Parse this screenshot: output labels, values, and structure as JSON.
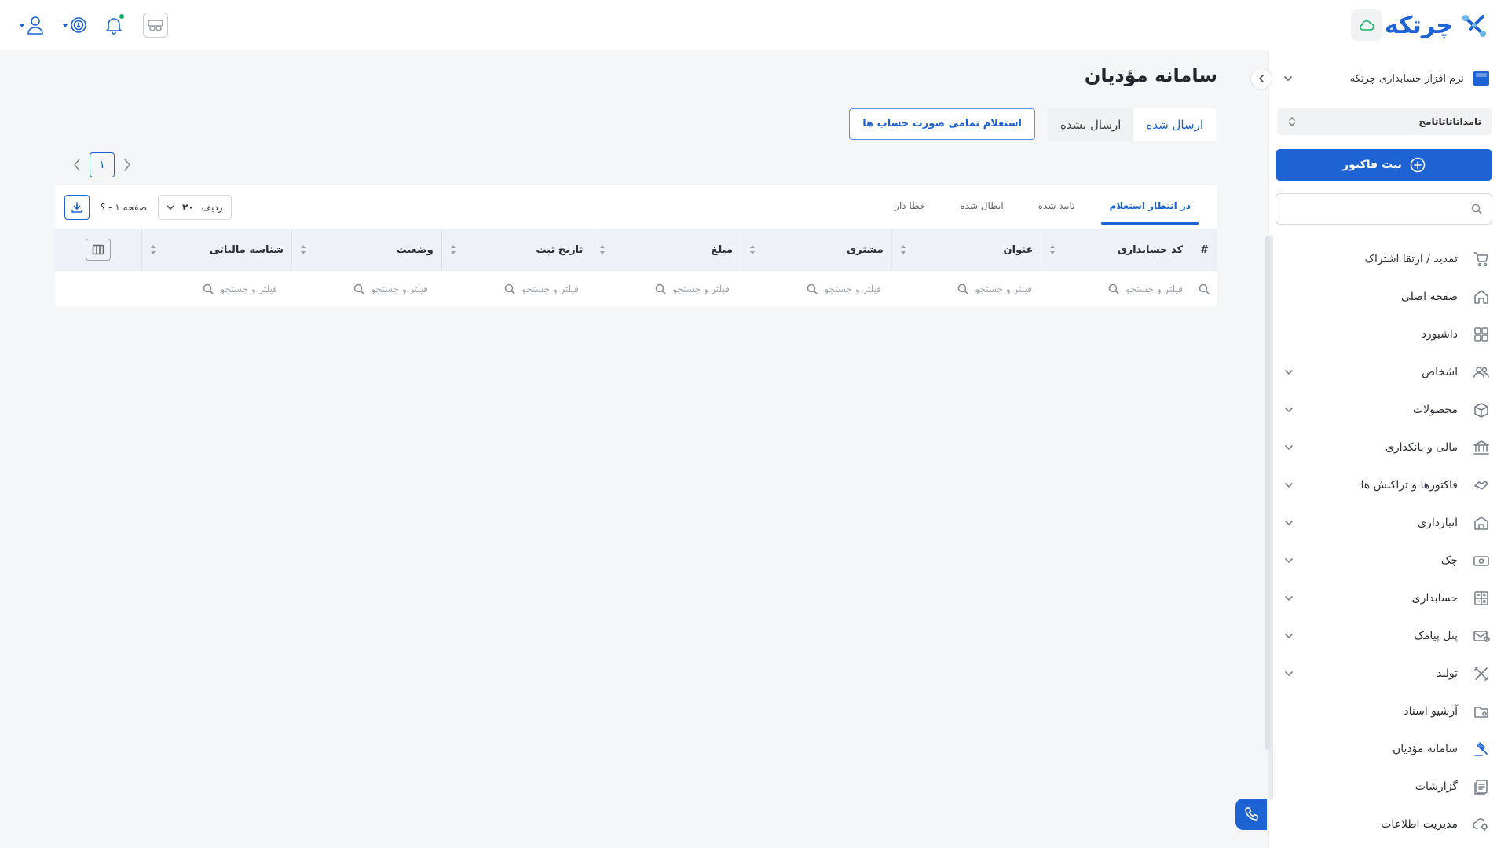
{
  "brand": {
    "name": "چرتکه"
  },
  "sidebar": {
    "company_name": "نرم افزار حسابداری چرتکه",
    "fiscal_select": "تامداتاتاتاتامخ",
    "primary_button": "ثبت فاکتور",
    "search_placeholder": "",
    "items": [
      {
        "label": "تمدید / ارتقا اشتراک",
        "icon": "cart-icon",
        "has_children": false
      },
      {
        "label": "صفحه اصلی",
        "icon": "home-icon",
        "has_children": false
      },
      {
        "label": "داشبورد",
        "icon": "dashboard-icon",
        "has_children": false
      },
      {
        "label": "اشخاص",
        "icon": "people-icon",
        "has_children": true
      },
      {
        "label": "محصولات",
        "icon": "box-icon",
        "has_children": true
      },
      {
        "label": "مالی و بانکداری",
        "icon": "bank-icon",
        "has_children": true
      },
      {
        "label": "فاکتورها و تراکنش ها",
        "icon": "handshake-icon",
        "has_children": true
      },
      {
        "label": "انبارداری",
        "icon": "warehouse-icon",
        "has_children": true
      },
      {
        "label": "چک",
        "icon": "cheque-icon",
        "has_children": true
      },
      {
        "label": "حسابداری",
        "icon": "calculator-icon",
        "has_children": true
      },
      {
        "label": "پنل پیامک",
        "icon": "sms-icon",
        "has_children": true
      },
      {
        "label": "تولید",
        "icon": "tools-icon",
        "has_children": true
      },
      {
        "label": "آرشیو اسناد",
        "icon": "archive-icon",
        "has_children": false
      },
      {
        "label": "سامانه مؤدیان",
        "icon": "gavel-icon",
        "has_children": false,
        "active": true
      },
      {
        "label": "گزارشات",
        "icon": "reports-icon",
        "has_children": false
      },
      {
        "label": "مدیریت اطلاعات",
        "icon": "data-settings-icon",
        "has_children": false
      }
    ]
  },
  "main": {
    "title": "سامانه مؤدیان",
    "send_tabs": [
      {
        "label": "ارسال شده",
        "active": true
      },
      {
        "label": "ارسال نشده",
        "active": false
      }
    ],
    "inquiry_button": "استعلام تمامی صورت حساب ها",
    "pager": {
      "current": "۱"
    },
    "status_tabs": [
      {
        "label": "در انتظار استعلام",
        "active": true
      },
      {
        "label": "تایید شده",
        "active": false
      },
      {
        "label": "ابطال شده",
        "active": false
      },
      {
        "label": "خطا دار",
        "active": false
      }
    ],
    "rows_label": "ردیف",
    "rows_value": "۲۰",
    "page_info": "صفحه ۱ - ؟",
    "columns": {
      "hash": "#",
      "code": "کد حسابداری",
      "title": "عنوان",
      "customer": "مشتری",
      "amount": "مبلغ",
      "date": "تاریخ ثبت",
      "status": "وضعیت",
      "tax_id": "شناسه مالیاتی"
    },
    "filter_placeholder": "فیلتر و جستجو"
  },
  "colors": {
    "primary": "#1e63d3",
    "success": "#17b26a",
    "background": "#f5f6f8"
  }
}
